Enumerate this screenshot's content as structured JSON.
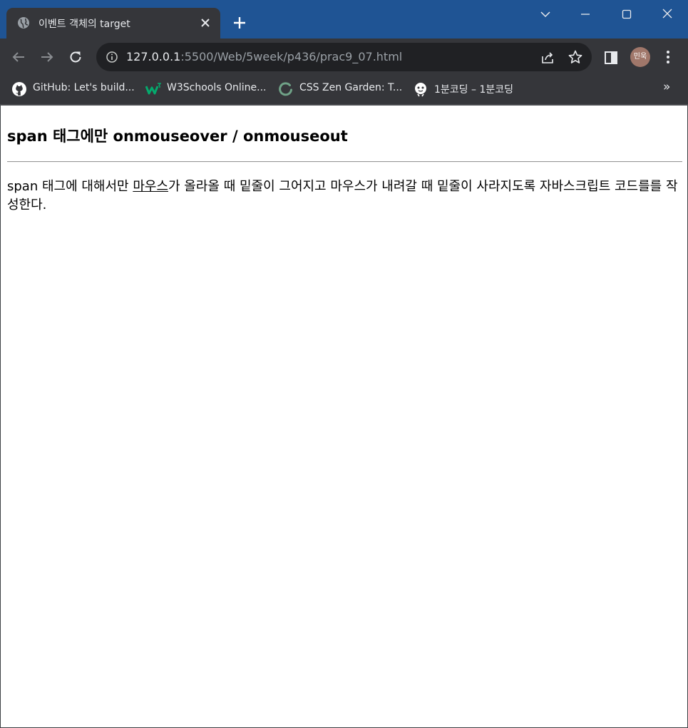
{
  "browser": {
    "tab": {
      "title": "이벤트 객체의 target"
    },
    "address": {
      "host": "127.0.0.1",
      "rest": ":5500/Web/5week/p436/prac9_07.html"
    },
    "profile": {
      "initials": "민욱"
    },
    "bookmarks": [
      {
        "label": "GitHub: Let's build...",
        "icon": "github-icon"
      },
      {
        "label": "W3Schools Online...",
        "icon": "w3schools-icon"
      },
      {
        "label": "CSS Zen Garden: T...",
        "icon": "zen-garden-icon"
      },
      {
        "label": "1분코딩 – 1분코딩",
        "icon": "1min-coding-icon"
      }
    ],
    "more_bookmarks": "»",
    "colors": {
      "title_bar": "#1f5494",
      "toolbar": "#35363a",
      "omnibox": "#202124"
    }
  },
  "page": {
    "heading": "span 태그에만 onmouseover / onmouseout",
    "paragraph": {
      "before": "span 태그에 대해서만 ",
      "span_text": "마우스",
      "after": "가 올라올 때 밑줄이 그어지고 마우스가 내려갈 때 밑줄이 사라지도록 자바스크립트 코드를를 작성한다."
    }
  }
}
